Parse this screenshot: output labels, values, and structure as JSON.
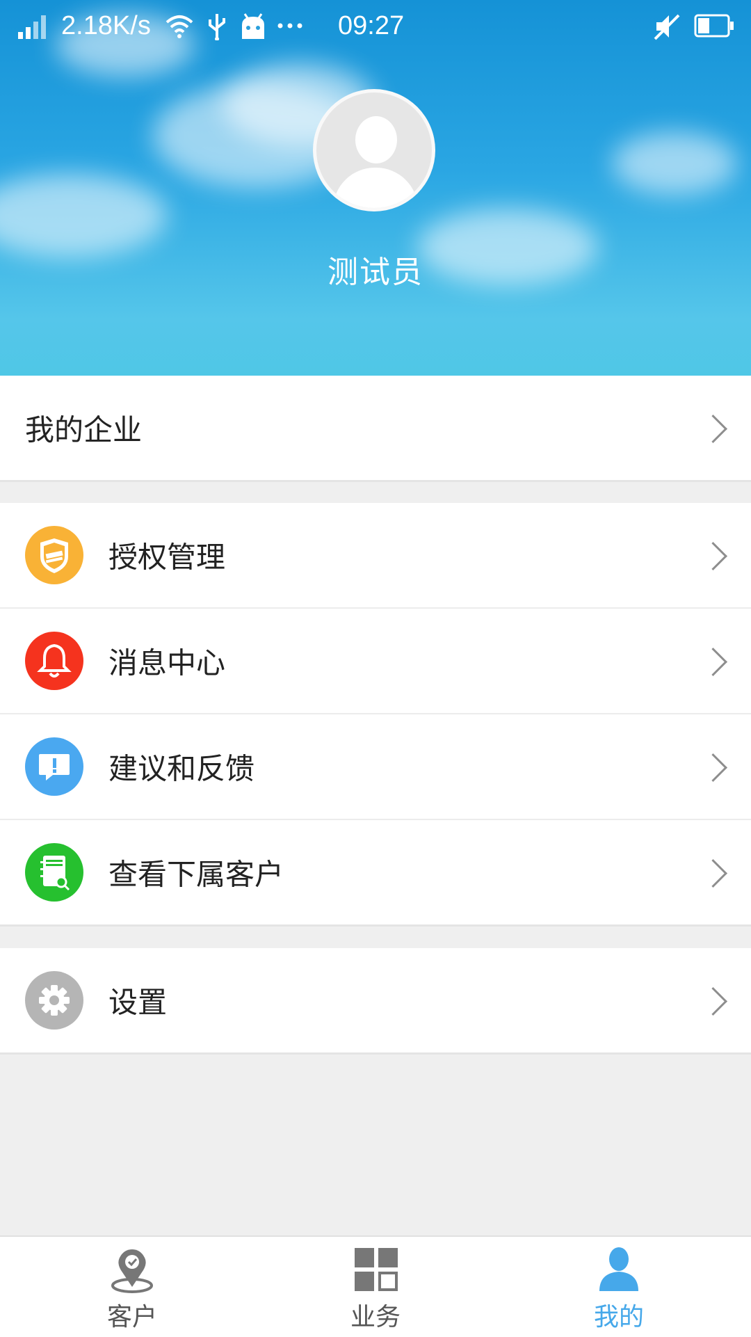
{
  "status_bar": {
    "speed": "2.18K/s",
    "time": "09:27",
    "icons": [
      "signal-icon",
      "wifi-icon",
      "usb-icon",
      "android-icon",
      "more-icon",
      "mute-icon",
      "battery-icon"
    ]
  },
  "profile": {
    "name": "测试员"
  },
  "enterprise": {
    "label": "我的企业"
  },
  "menu": [
    {
      "label": "授权管理",
      "icon": "shield-icon",
      "color": "#f9b236"
    },
    {
      "label": "消息中心",
      "icon": "bell-icon",
      "color": "#f5331e"
    },
    {
      "label": "建议和反馈",
      "icon": "feedback-icon",
      "color": "#4aa8f0"
    },
    {
      "label": "查看下属客户",
      "icon": "contacts-search-icon",
      "color": "#26c02f"
    }
  ],
  "settings": {
    "label": "设置",
    "icon": "gear-icon",
    "color": "#b5b5b5"
  },
  "bottom_nav": [
    {
      "label": "客户",
      "icon": "location-pin-icon",
      "active": false
    },
    {
      "label": "业务",
      "icon": "grid-icon",
      "active": false
    },
    {
      "label": "我的",
      "icon": "person-icon",
      "active": true
    }
  ],
  "colors": {
    "accent": "#46a8ea",
    "background": "#efefef"
  }
}
